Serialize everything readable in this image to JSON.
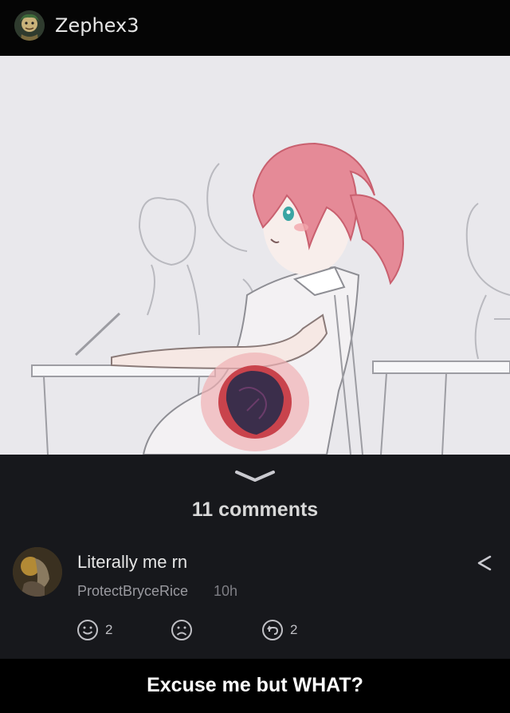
{
  "post": {
    "username": "Zephex3",
    "caption": "Excuse me but WHAT?"
  },
  "comments_section": {
    "count_label": "11 comments",
    "comment": {
      "text": "Literally me rn",
      "author": "ProtectBryceRice",
      "time": "10h",
      "like_count": "2",
      "reply_count": "2"
    }
  },
  "icons": [
    "avatar",
    "chevron-down-icon",
    "share-icon",
    "smile-icon",
    "frown-icon",
    "reply-icon"
  ],
  "colors": {
    "background": "#000000",
    "panel": "#17181c",
    "hair": "#e58a97",
    "wound": "#b32a35"
  }
}
